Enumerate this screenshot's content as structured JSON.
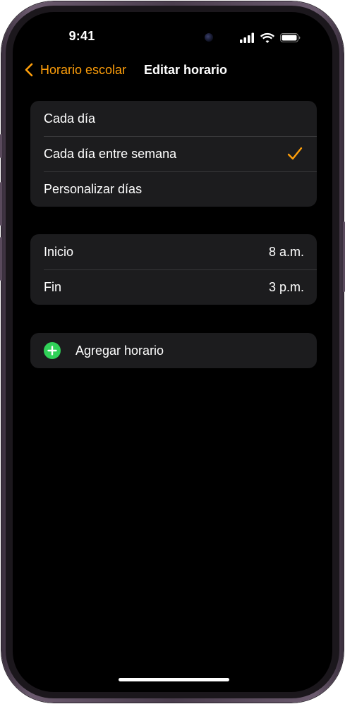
{
  "status_bar": {
    "time": "9:41"
  },
  "nav": {
    "back_label": "Horario escolar",
    "title": "Editar horario"
  },
  "repeat_options": [
    {
      "label": "Cada día",
      "selected": false
    },
    {
      "label": "Cada día entre semana",
      "selected": true
    },
    {
      "label": "Personalizar días",
      "selected": false
    }
  ],
  "times": {
    "start": {
      "label": "Inicio",
      "value": "8 a.m."
    },
    "end": {
      "label": "Fin",
      "value": "3 p.m."
    }
  },
  "add_schedule": {
    "label": "Agregar horario"
  },
  "colors": {
    "accent": "#ff9f0a",
    "add_green": "#30d158",
    "cell_bg": "#1c1c1e",
    "separator": "#38383a"
  }
}
